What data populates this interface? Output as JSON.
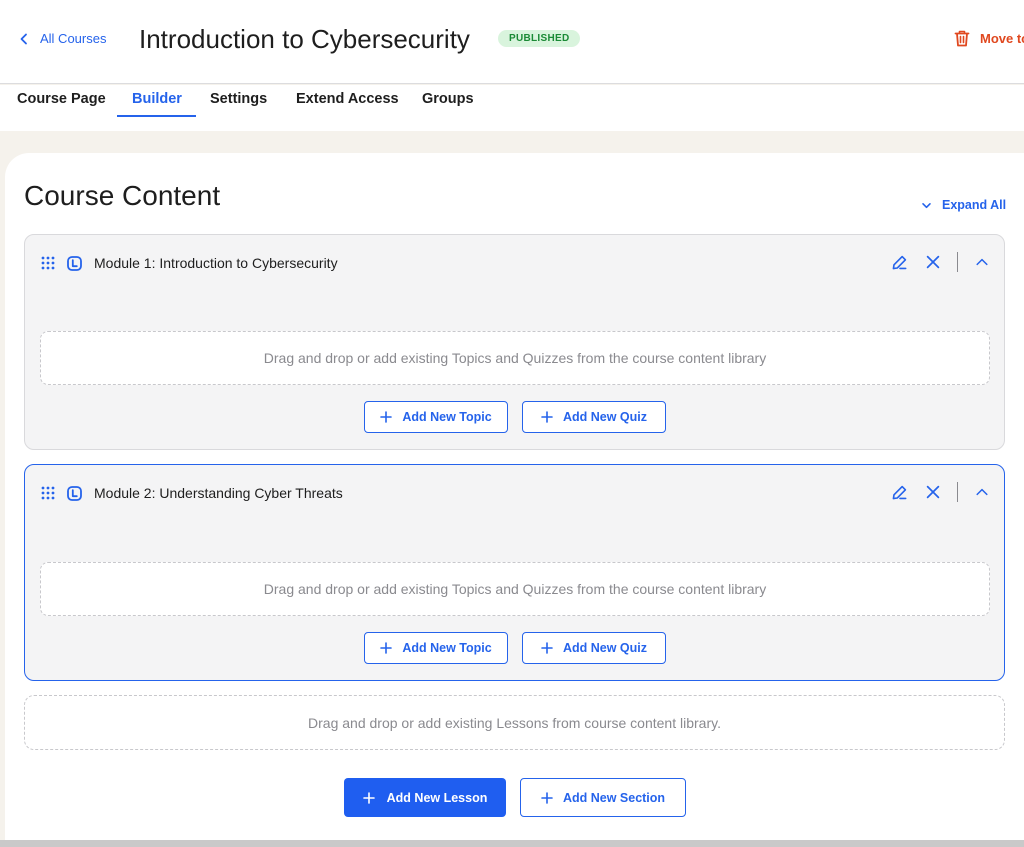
{
  "header": {
    "back_label": "All Courses",
    "course_title": "Introduction to Cybersecurity",
    "status": "PUBLISHED",
    "trash_label": "Move to"
  },
  "tabs": [
    {
      "label": "Course Page",
      "active": false
    },
    {
      "label": "Builder",
      "active": true
    },
    {
      "label": "Settings",
      "active": false
    },
    {
      "label": "Extend Access",
      "active": false
    },
    {
      "label": "Groups",
      "active": false
    }
  ],
  "content": {
    "heading": "Course Content",
    "expand_all_label": "Expand All",
    "modules": [
      {
        "title": "Module 1: Introduction to Cybersecurity",
        "dropzone_text": "Drag and drop or add existing Topics and Quizzes from the course content library",
        "add_topic_label": "Add New Topic",
        "add_quiz_label": "Add New Quiz"
      },
      {
        "title": "Module 2: Understanding Cyber Threats",
        "dropzone_text": "Drag and drop or add existing Topics and Quizzes from the course content library",
        "add_topic_label": "Add New Topic",
        "add_quiz_label": "Add New Quiz"
      }
    ],
    "lesson_dropzone_text": "Drag and drop or add existing Lessons from course content library.",
    "add_lesson_label": "Add New Lesson",
    "add_section_label": "Add New Section"
  },
  "colors": {
    "accent": "#2563eb",
    "danger": "#e0481f",
    "published_bg": "#d9f4dd",
    "published_fg": "#1a8a35"
  }
}
